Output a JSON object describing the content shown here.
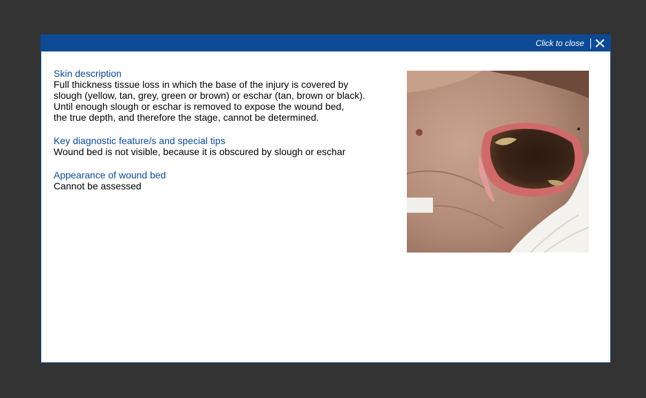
{
  "modal": {
    "close_label": "Click to close",
    "close_icon": "close-x-icon",
    "accent_color": "#0d4a95"
  },
  "sections": [
    {
      "heading": "Skin description",
      "body": "Full thickness tissue loss in which the base of the injury is covered by\nslough (yellow, tan, grey, green or brown) or eschar (tan, brown or black).\nUntil enough slough or eschar is removed to expose the wound bed,\nthe true depth, and therefore the stage, cannot be determined."
    },
    {
      "heading": "Key diagnostic feature/s and special tips",
      "body": "Wound bed is not visible, because it is obscured by slough or eschar"
    },
    {
      "heading": "Appearance of wound bed",
      "body": "Cannot be assessed"
    }
  ]
}
